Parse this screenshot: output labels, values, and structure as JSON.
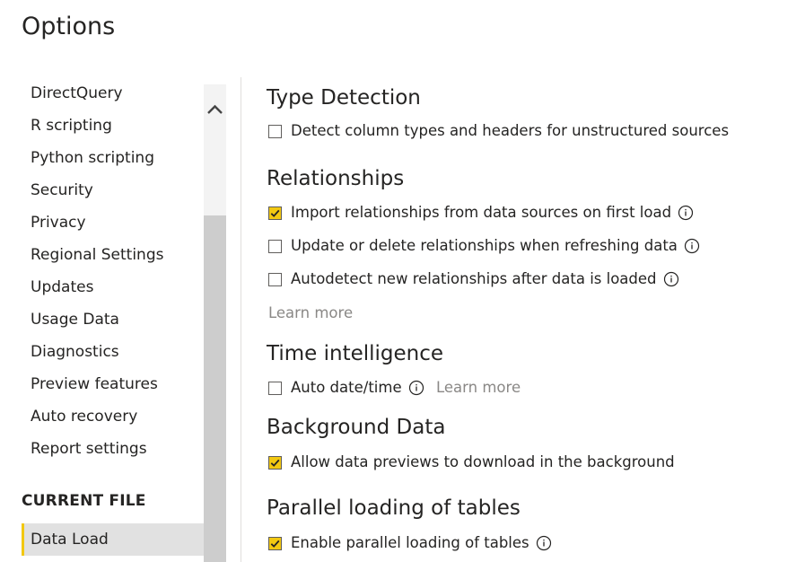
{
  "window": {
    "title": "Options"
  },
  "sidebar": {
    "items": [
      {
        "label": "DirectQuery"
      },
      {
        "label": "R scripting"
      },
      {
        "label": "Python scripting"
      },
      {
        "label": "Security"
      },
      {
        "label": "Privacy"
      },
      {
        "label": "Regional Settings"
      },
      {
        "label": "Updates"
      },
      {
        "label": "Usage Data"
      },
      {
        "label": "Diagnostics"
      },
      {
        "label": "Preview features"
      },
      {
        "label": "Auto recovery"
      },
      {
        "label": "Report settings"
      }
    ],
    "current_file_heading": "CURRENT FILE",
    "selected_item": "Data Load"
  },
  "main": {
    "type_detection": {
      "heading": "Type Detection",
      "detect_types_label": "Detect column types and headers for unstructured sources",
      "detect_types_checked": false
    },
    "relationships": {
      "heading": "Relationships",
      "import_label": "Import relationships from data sources on first load",
      "import_checked": true,
      "update_delete_label": "Update or delete relationships when refreshing data",
      "update_delete_checked": false,
      "autodetect_label": "Autodetect new relationships after data is loaded",
      "autodetect_checked": false,
      "learn_more": "Learn more"
    },
    "time_intelligence": {
      "heading": "Time intelligence",
      "auto_date_label": "Auto date/time",
      "auto_date_checked": false,
      "learn_more": "Learn more"
    },
    "background_data": {
      "heading": "Background Data",
      "allow_previews_label": "Allow data previews to download in the background",
      "allow_previews_checked": true
    },
    "parallel_loading": {
      "heading": "Parallel loading of tables",
      "enable_parallel_label": "Enable parallel loading of tables",
      "enable_parallel_checked": true
    }
  },
  "icons": {
    "checkmark": "checkmark-icon",
    "info": "info-icon",
    "scroll_up": "chevron-up-icon"
  },
  "colors": {
    "accent": "#f2c811",
    "text": "#252423",
    "muted_link": "#8a8886",
    "selected_bg": "#e1e1e1"
  }
}
